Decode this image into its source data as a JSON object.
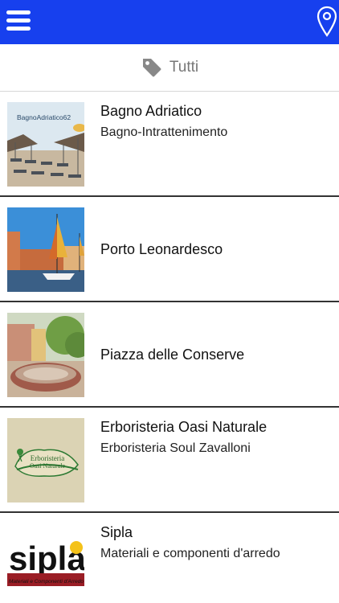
{
  "header": {
    "menu_icon": "hamburger-menu-icon",
    "map_icon": "map-pin-icon",
    "background": "#1740ee"
  },
  "filter": {
    "icon": "tag-icon",
    "label": "Tutti"
  },
  "items": [
    {
      "title": "Bagno Adriatico",
      "subtitle": "Bagno-Intrattenimento",
      "thumb_text": "BagnoAdriatico62"
    },
    {
      "title": "Porto Leonardesco",
      "subtitle": ""
    },
    {
      "title": "Piazza delle Conserve",
      "subtitle": ""
    },
    {
      "title": "Erboristeria Oasi Naturale",
      "subtitle": "Erboristeria Soul Zavalloni",
      "thumb_text_1": "Erboristeria",
      "thumb_text_2": "Oasi Naturale"
    },
    {
      "title": "Sipla",
      "subtitle": "Materiali e componenti d'arredo",
      "thumb_text": "sipla",
      "thumb_caption": "Materiali e Componenti d'Arredo"
    }
  ]
}
